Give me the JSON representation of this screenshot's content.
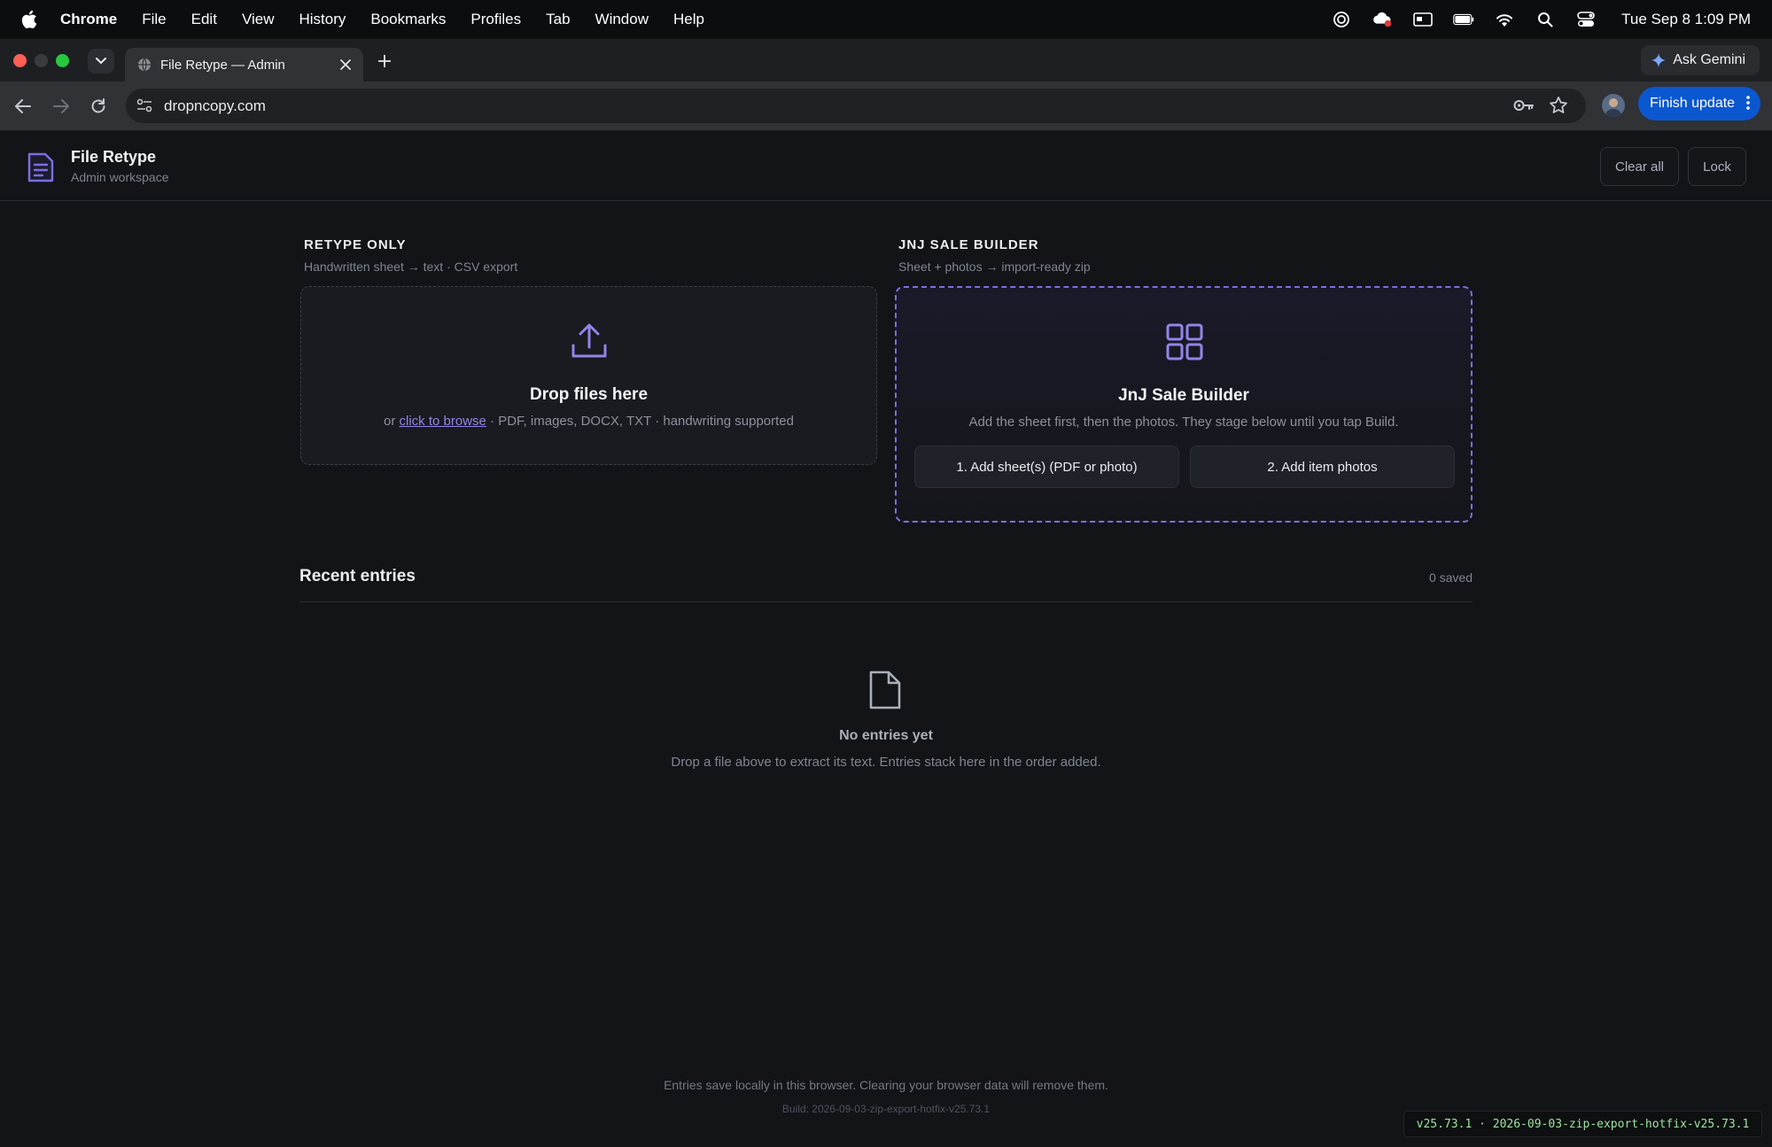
{
  "menubar": {
    "app": "Chrome",
    "items": [
      "File",
      "Edit",
      "View",
      "History",
      "Bookmarks",
      "Profiles",
      "Tab",
      "Window",
      "Help"
    ],
    "clock": "Tue Sep 8  1:09 PM"
  },
  "browser": {
    "tab_title": "File Retype — Admin",
    "url": "dropncopy.com",
    "ask_gemini": "Ask Gemini",
    "finish_update": "Finish update",
    "accent": "#0b57d0"
  },
  "app": {
    "title": "File Retype",
    "subtitle": "Admin workspace",
    "clear_all": "Clear all",
    "lock": "Lock",
    "accent": "#7c6ee0"
  },
  "retype": {
    "heading": "RETYPE ONLY",
    "subheading": "Handwritten sheet → text · CSV export",
    "drop_title": "Drop files here",
    "drop_prefix": "or ",
    "browse_link": "click to browse",
    "drop_suffix": " · PDF, images, DOCX, TXT · handwriting supported",
    "icon": "upload-icon"
  },
  "builder": {
    "heading": "JNJ SALE BUILDER",
    "subheading": "Sheet + photos → import-ready zip",
    "title": "JnJ Sale Builder",
    "description": "Add the sheet first, then the photos. They stage below until you tap Build.",
    "step1": "1. Add sheet(s) (PDF or photo)",
    "step2": "2. Add item photos",
    "icon": "grid-icon"
  },
  "recent": {
    "title": "Recent entries",
    "count": "0 saved",
    "empty_title": "No entries yet",
    "empty_subtitle": "Drop a file above to extract its text. Entries stack here in the order added.",
    "icon": "file-icon"
  },
  "footer": {
    "note": "Entries save locally in this browser. Clearing your browser data will remove them.",
    "build": "Build: 2026-09-03-zip-export-hotfix-v25.73.1"
  },
  "version_badge": "v25.73.1 · 2026-09-03-zip-export-hotfix-v25.73.1"
}
